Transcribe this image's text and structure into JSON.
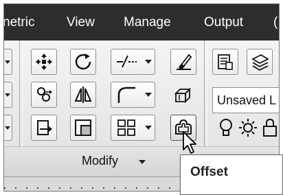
{
  "menu": {
    "items": [
      "netric",
      "View",
      "Manage",
      "Output",
      "("
    ]
  },
  "panel": {
    "title": "Modify"
  },
  "right_panel": {
    "style_field": "Unsaved L"
  },
  "tooltip": {
    "text": "Offset"
  },
  "tools": {
    "row1": [
      "move-icon",
      "rotate-icon",
      "trim-icon",
      "erase-icon"
    ],
    "row2": [
      "copy-icon",
      "mirror-icon",
      "fillet-icon",
      "3d-box-icon"
    ],
    "row3": [
      "stretch-icon",
      "scale-icon",
      "array-icon",
      "offset-icon"
    ]
  },
  "colors": {
    "menubar_bg": "#2d2d2d",
    "ribbon_bg": "#e8e8e8",
    "accent_text": "#ffffff"
  }
}
